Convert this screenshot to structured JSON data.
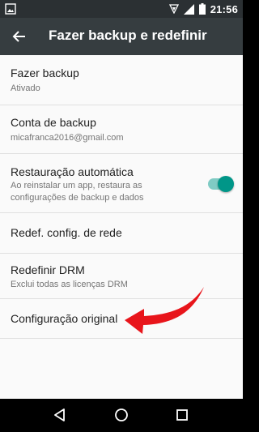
{
  "status_bar": {
    "time": "21:56"
  },
  "toolbar": {
    "title": "Fazer backup e redefinir"
  },
  "items": [
    {
      "title": "Fazer backup",
      "subtitle": "Ativado"
    },
    {
      "title": "Conta de backup",
      "subtitle": "micafranca2016@gmail.com"
    },
    {
      "title": "Restauração automática",
      "subtitle": "Ao reinstalar um app, restaura as configurações de backup e dados",
      "toggle_on": true
    },
    {
      "title": "Redef. config. de rede"
    },
    {
      "title": "Redefinir DRM",
      "subtitle": "Exclui todas as licenças DRM"
    },
    {
      "title": "Configuração original"
    }
  ],
  "colors": {
    "accent": "#009688",
    "annotation_arrow": "#e8151b",
    "toolbar": "#363d40",
    "status_bar": "#2b3033"
  }
}
